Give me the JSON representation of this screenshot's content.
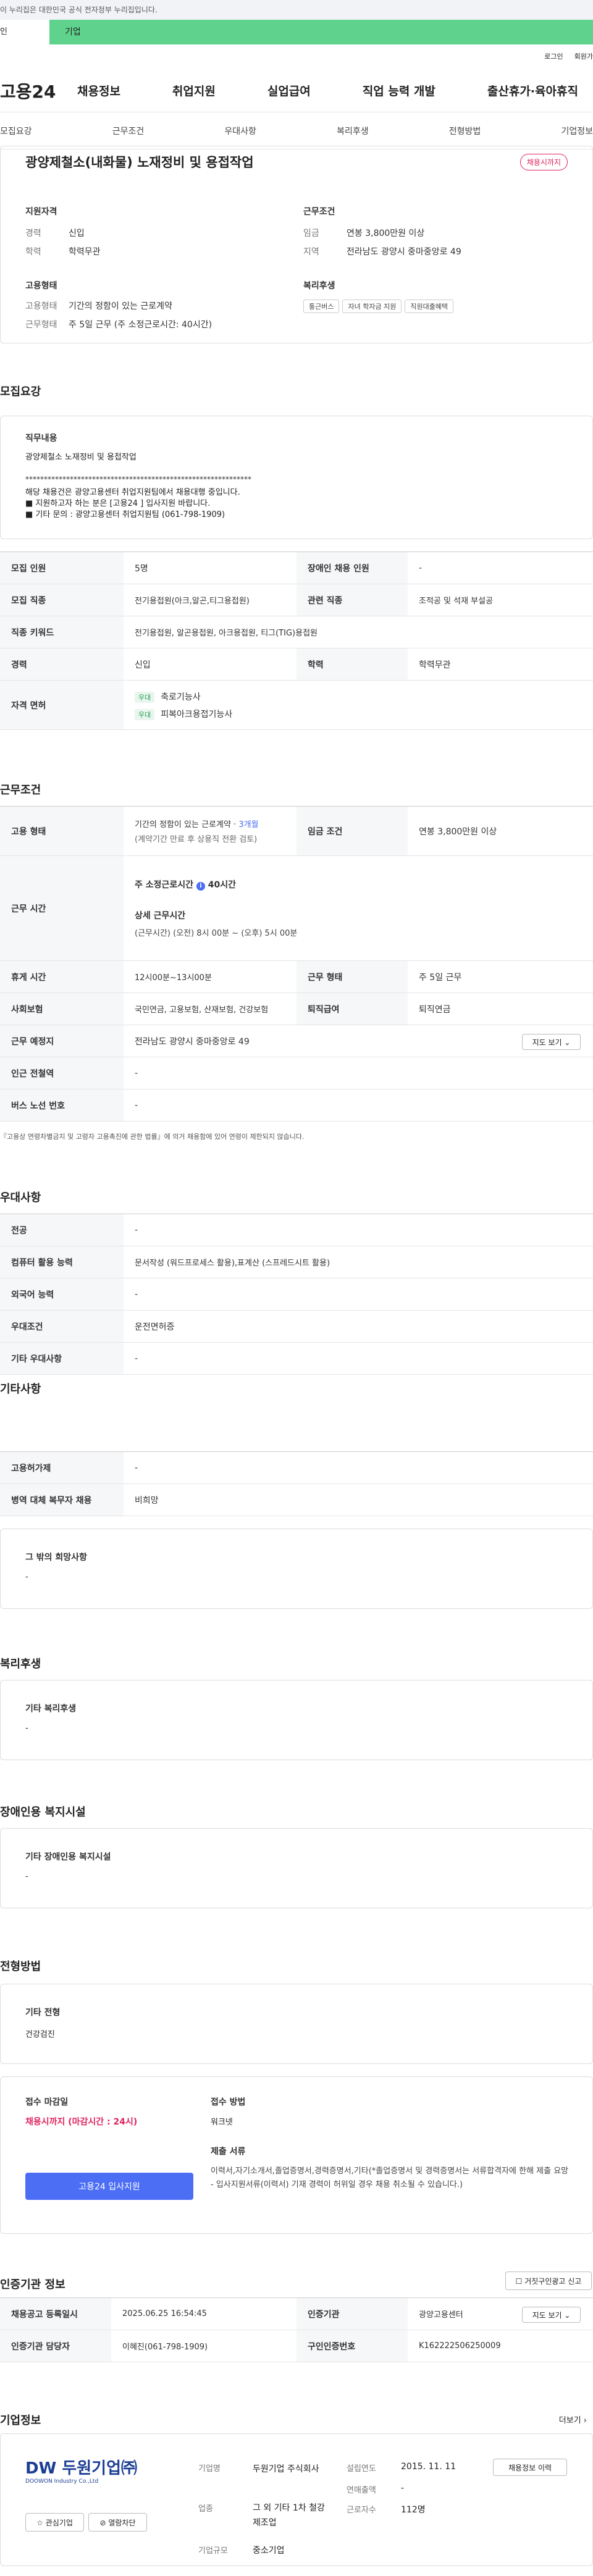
{
  "top": {
    "gov": "이 누리집은 대한민국 공식 전자정부 누리집입니다.",
    "tab_person": "인",
    "tab_corp": "기업",
    "login": "로그인",
    "join": "회원가"
  },
  "gnb": {
    "logo": "고용24",
    "items": [
      "채용정보",
      "취업지원",
      "실업급여",
      "직업 능력 개발",
      "출산휴가·육아휴직"
    ]
  },
  "anchor": [
    "모집요강",
    "근무조건",
    "우대사항",
    "복리후생",
    "전형방법",
    "기업정보"
  ],
  "job": {
    "title": "광양제철소(내화물) 노재정비 및 용접작업",
    "badge": "채용시까지",
    "qual_title": "지원자격",
    "exp_k": "경력",
    "exp_v": "신입",
    "edu_k": "학력",
    "edu_v": "학력무관",
    "cond_title": "근무조건",
    "wage_k": "임금",
    "wage_v": "연봉 3,800만원 이상",
    "area_k": "지역",
    "area_v": "전라남도 광양시 중마중앙로 49",
    "emp_title": "고용형태",
    "etype_k": "고용형태",
    "etype_v": "기간의 정함이 있는 근로계약",
    "wtype_k": "근무형태",
    "wtype_v": "주 5일 근무 (주 소정근로시간: 40시간)",
    "welfare_title": "복리후생",
    "welfare": [
      "통근버스",
      "자녀 학자금 지원",
      "직원대출혜택"
    ]
  },
  "recruit": {
    "heading": "모집요강",
    "duty_title": "직무내용",
    "duty_line": "광양제철소 노재정비 및 용접작업",
    "stars": "*************************************************************",
    "notes": [
      "해당 채용건은 광양고용센터 취업지원팀에서 채용대행 중입니다.",
      "■ 지원하고자 하는 분은 [고용24 ] 입사지원 바랍니다.",
      "■ 기타 문의 : 광양고용센터 취업지원팀 (061-798-1909)"
    ],
    "r1": [
      "모집 인원",
      "5명",
      "장애인 채용 인원",
      "-"
    ],
    "r2": [
      "모집 직종",
      "전기용접원(아크,알곤,티그용접원)",
      "관련 직종",
      "조적공 및 석재 부설공"
    ],
    "r3": [
      "직종 키워드",
      "전기용접원, 알곤용접원, 아크용접원, 티그(TIG)용접원"
    ],
    "r4": [
      "경력",
      "신입",
      "학력",
      "학력무관"
    ],
    "lic_k": "자격 면허",
    "lic_badge": "우대",
    "lic": [
      "축로기능사",
      "피복아크용접기능사"
    ]
  },
  "work": {
    "heading": "근무조건",
    "emp_k": "고용 형태",
    "emp_v1": "기간의 정함이 있는 근로계약 · ",
    "emp_v1b": "3개월",
    "emp_v2": "(계약기간 만료 후 상용직 전환 검토)",
    "wage_k": "임금 조건",
    "wage_v": "연봉 3,800만원 이상",
    "hours_k": "근무 시간",
    "hours_main": "주 소정근로시간 ",
    "hours_badge": "i",
    "hours_val": "40시간",
    "hours_detail": "상세 근무시간",
    "hours_detail_v": "(근무시간) (오전) 8시 00분 ~ (오후) 5시 00분",
    "rest_k": "휴게 시간",
    "rest_v": "12시00분~13시00분",
    "wtype_k": "근무 형태",
    "wtype_v": "주 5일 근무",
    "ins_k": "사회보험",
    "ins_v": "국민연금, 고용보험, 산재보험, 건강보험",
    "ret_k": "퇴직급여",
    "ret_v": "퇴직연금",
    "place_k": "근무 예정지",
    "place_v": "전라남도 광양시 중마중앙로 49",
    "map_btn": "지도 보기 ⌄",
    "station_k": "인근 전철역",
    "station_v": "-",
    "bus_k": "버스 노선 번호",
    "bus_v": "-",
    "note": "『고용상 연령차별금지 및 고령자 고용촉진에 관한 법률』에 의거 채용함에 있어 연령이 제한되지 않습니다."
  },
  "pref": {
    "heading": "우대사항",
    "rows": [
      [
        "전공",
        "-"
      ],
      [
        "컴퓨터 활용 능력",
        "문서작성 (워드프로세스 활용),표계산 (스프레드시트 활용)"
      ],
      [
        "외국어 능력",
        "-"
      ],
      [
        "우대조건",
        "운전면허증"
      ],
      [
        "기타 우대사항",
        "-"
      ]
    ]
  },
  "etc": {
    "heading": "기타사항",
    "rows": [
      [
        "고용허가제",
        "-"
      ],
      [
        "병역 대체 복무자 채용",
        "비희망"
      ]
    ],
    "other_title": "그 밖의 희망사항",
    "other_v": "-"
  },
  "welfare": {
    "heading": "복리후생",
    "title": "기타 복리후생",
    "v": "-"
  },
  "disab": {
    "heading": "장애인용 복지시설",
    "title": "기타 장애인용 복지시설",
    "v": "-"
  },
  "screen": {
    "heading": "전형방법",
    "title": "기타 전형",
    "v": "건강검진"
  },
  "apply": {
    "deadline_k": "접수 마감일",
    "deadline_v": "채용시까지 (마감시간 : 24시)",
    "method_k": "접수 방법",
    "method_v": "워크넷",
    "btn": "고용24 입사지원",
    "docs_k": "제출 서류",
    "docs_v": "이력서,자기소개서,졸업증명서,경력증명서,기타(*졸업증명서 및 경력증명서는 서류합격자에 한해 제출 요망 - 입사지원서류(이력서) 기재 경력이 허위일 경우 채용 취소될 수 있습니다.)"
  },
  "cert": {
    "heading": "인증기관 정보",
    "report_btn": "☐ 거짓구인광고 신고",
    "r1": [
      "채용공고 등록일시",
      "2025.06.25 16:54:45",
      "인증기관",
      "광양고용센터"
    ],
    "map_btn": "지도 보기 ⌄",
    "r2": [
      "인증기관 담당자",
      "이혜진(061-798-1909)",
      "구인인증번호",
      "K162222506250009"
    ]
  },
  "company": {
    "heading": "기업정보",
    "more": "더보기 ›",
    "logo_text": "DW 두원기업㈜",
    "logo_sub": "DOOWON Industry Co.,Ltd",
    "fav_btn": "☆ 관심기업",
    "block_btn": "⊘ 열람차단",
    "name_k": "기업명",
    "name_v": "두원기업 주식회사",
    "found_k": "설립연도",
    "found_v": "2015. 11. 11",
    "info_btn": "채용정보 이력",
    "sales_k": "연매출액",
    "sales_v": "-",
    "ind_k": "업종",
    "ind_v": "그 외 기타 1차 철강 제조업",
    "emp_k": "근로자수",
    "emp_v": "112명",
    "size_k": "기업규모",
    "size_v": "중소기업"
  },
  "colors": {
    "green": "#5fd38d",
    "pink": "#e0245e",
    "blue": "#4c6ef5"
  }
}
